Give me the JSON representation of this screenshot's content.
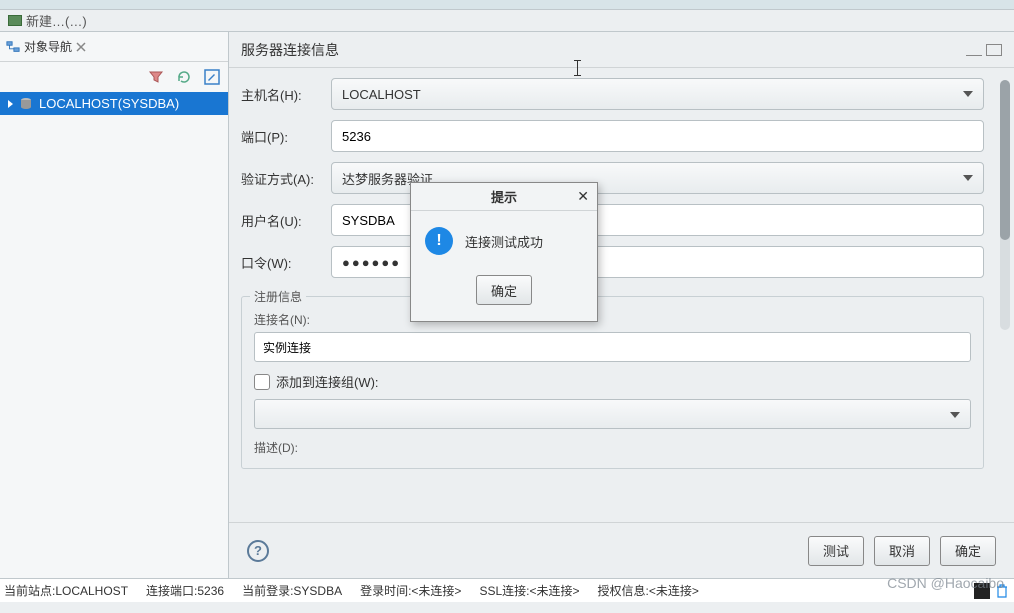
{
  "toolbar": {
    "first_tab": "新建…(…)"
  },
  "sidebar": {
    "tab_label": "对象导航",
    "tree_item": "LOCALHOST(SYSDBA)"
  },
  "content": {
    "title": "服务器连接信息",
    "labels": {
      "host": "主机名(H):",
      "port": "端口(P):",
      "auth": "验证方式(A):",
      "user": "用户名(U):",
      "pass": "口令(W):"
    },
    "values": {
      "host": "LOCALHOST",
      "port": "5236",
      "auth": "达梦服务器验证",
      "user": "SYSDBA",
      "pass": "●●●●●●"
    },
    "register": {
      "legend": "注册信息",
      "conn_name_label": "连接名(N):",
      "conn_name_value": "实例连接",
      "add_group_label": "添加到连接组(W):",
      "desc_label": "描述(D):"
    },
    "buttons": {
      "test": "测试",
      "cancel": "取消",
      "ok": "确定"
    }
  },
  "modal": {
    "title": "提示",
    "message": "连接测试成功",
    "ok": "确定"
  },
  "status": {
    "site": "当前站点:LOCALHOST",
    "port": "连接端口:5236",
    "login": "当前登录:SYSDBA",
    "login_time": "登录时间:<未连接>",
    "ssl": "SSL连接:<未连接>",
    "auth": "授权信息:<未连接>"
  },
  "watermark": "CSDN @Haocaibo"
}
